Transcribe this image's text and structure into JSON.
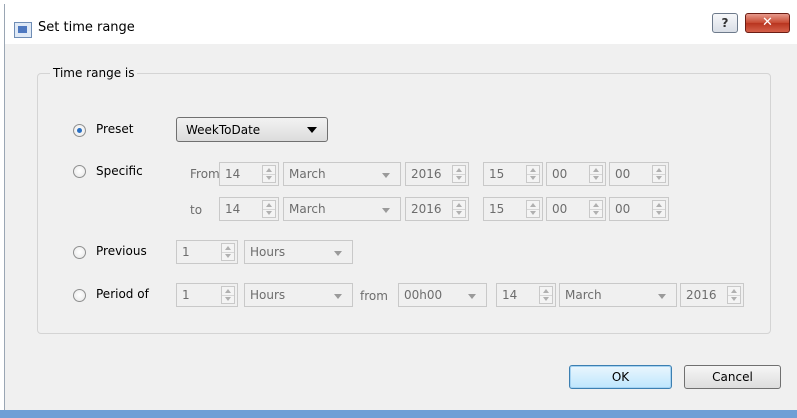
{
  "window": {
    "title": "Set time range",
    "help_label": "?",
    "close_label": "✕"
  },
  "group": {
    "title": "Time range is"
  },
  "options": {
    "preset": {
      "label": "Preset",
      "checked": true,
      "value": "WeekToDate"
    },
    "specific": {
      "label": "Specific",
      "checked": false,
      "from": {
        "label": "From",
        "day": "14",
        "month": "March",
        "year": "2016",
        "hour": "15",
        "minute": "00",
        "second": "00"
      },
      "to": {
        "label": "to",
        "day": "14",
        "month": "March",
        "year": "2016",
        "hour": "15",
        "minute": "00",
        "second": "00"
      }
    },
    "previous": {
      "label": "Previous",
      "checked": false,
      "count": "1",
      "unit": "Hours"
    },
    "period_of": {
      "label": "Period of",
      "checked": false,
      "count": "1",
      "unit": "Hours",
      "from_label": "from",
      "time": "00h00",
      "day": "14",
      "month": "March",
      "year": "2016"
    }
  },
  "buttons": {
    "ok": "OK",
    "cancel": "Cancel"
  },
  "colors": {
    "accent": "#2a6fc2",
    "close_button": "#c64830",
    "disabled_text": "#6d6d6d"
  }
}
